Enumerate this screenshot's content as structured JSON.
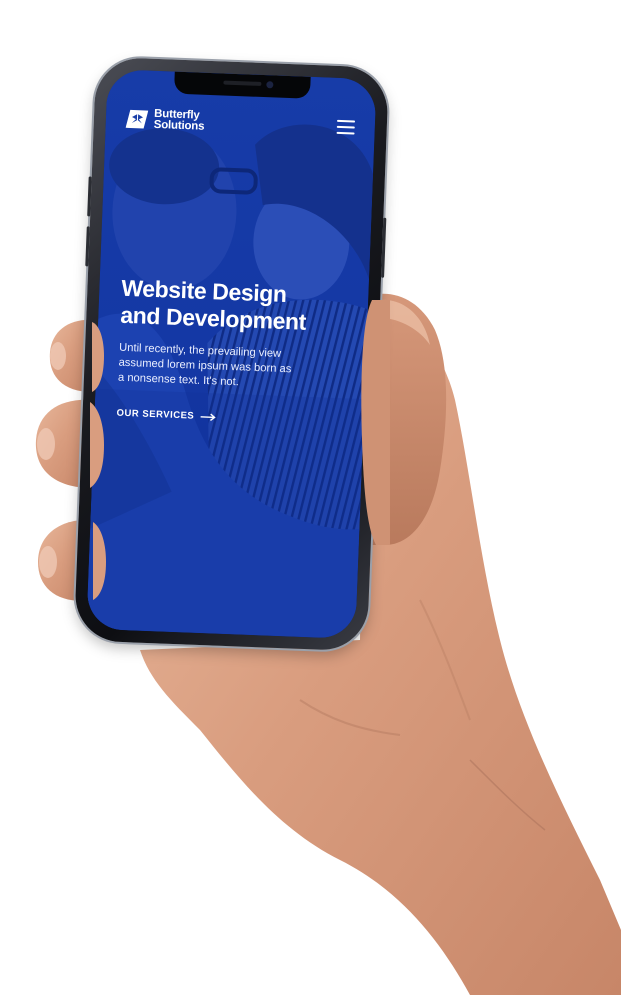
{
  "brand": {
    "name_line1": "Butterfly",
    "name_line2": "Solutions",
    "logo_icon": "butterfly-logo-icon"
  },
  "header": {
    "menu_icon": "hamburger-menu-icon"
  },
  "hero": {
    "title_line1": "Website Design",
    "title_line2": "and Development",
    "body": "Until recently, the prevailing view assumed lorem ipsum was born as a nonsense text. It's not.",
    "cta_label": "OUR SERVICES",
    "cta_icon": "arrow-right-icon"
  },
  "colors": {
    "screen_overlay": "#1236a8",
    "text": "#ffffff",
    "page_background": "#ffffff"
  }
}
